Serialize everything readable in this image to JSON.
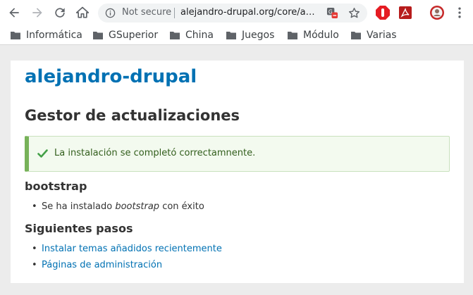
{
  "browser": {
    "security_label": "Not secure",
    "url": "alejandro-drupal.org/core/authorize.php"
  },
  "bookmarks": [
    {
      "label": "Informática"
    },
    {
      "label": "GSuperior"
    },
    {
      "label": "China"
    },
    {
      "label": "Juegos"
    },
    {
      "label": "Módulo"
    },
    {
      "label": "Varias"
    }
  ],
  "icons": {
    "back": "back-arrow-icon",
    "forward": "forward-arrow-icon",
    "reload": "reload-icon",
    "home": "home-icon",
    "info": "info-icon",
    "translate": "translate-icon",
    "star": "star-icon",
    "folder": "folder-icon",
    "check": "checkmark-icon"
  },
  "colors": {
    "site_link": "#0071b3",
    "status_border": "#77b259",
    "status_bg": "#f3faef",
    "status_text": "#325e1c"
  },
  "page": {
    "site_name": "alejandro-drupal",
    "title": "Gestor de actualizaciones",
    "status_message": "La instalación se completó correctamnente.",
    "project_heading": "bootstrap",
    "project_item_prefix": "Se ha instalado",
    "project_item_name": "bootstrap",
    "project_item_suffix": "con éxito",
    "next_steps_heading": "Siguientes pasos",
    "next_steps": [
      {
        "label": "Instalar temas añadidos recientemente"
      },
      {
        "label": "Páginas de administración"
      }
    ]
  }
}
